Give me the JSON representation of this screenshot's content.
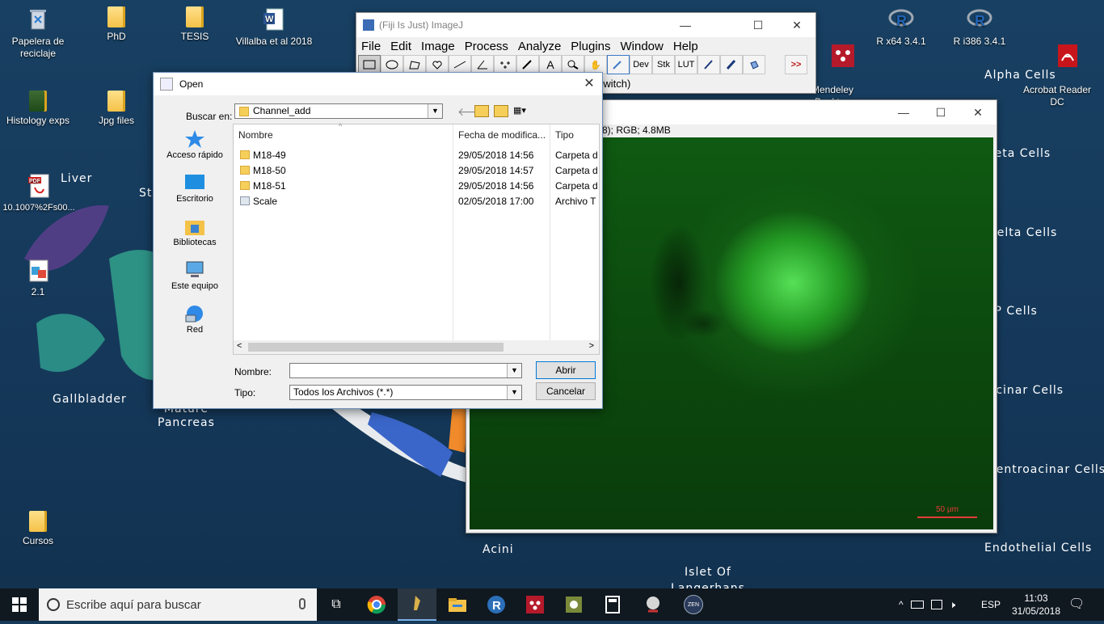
{
  "desktop": {
    "icons": [
      {
        "label": "Papelera de\nreciclaje",
        "icon": "recycle-bin-icon"
      },
      {
        "label": "PhD",
        "icon": "folder-icon"
      },
      {
        "label": "TESIS",
        "icon": "folder-icon"
      },
      {
        "label": "Villalba et al 2018",
        "icon": "word-doc-icon"
      },
      {
        "label": "Histology exps",
        "icon": "folder-icon"
      },
      {
        "label": "Jpg files",
        "icon": "folder-icon"
      },
      {
        "label": "10.1007%2Fs00...",
        "icon": "pdf-icon"
      },
      {
        "label": "2.1",
        "icon": "app-icon"
      },
      {
        "label": "Cursos",
        "icon": "folder-icon"
      },
      {
        "label": "Mendeley\nDesktop",
        "icon": "mendeley-icon"
      },
      {
        "label": "R x64 3.4.1",
        "icon": "r-icon"
      },
      {
        "label": "R i386 3.4.1",
        "icon": "r-icon"
      },
      {
        "label": "Acrobat Reader\nDC",
        "icon": "acrobat-icon"
      }
    ],
    "wallpaper_labels": [
      "Liver",
      "Gallbladder",
      "Mature\nPancreas",
      "Alpha Cells",
      "Beta Cells",
      "Delta Cells",
      "PP Cells",
      "Acinar Cells",
      "Centroacinar Cells",
      "Endothelial Cells",
      "Acini",
      "Islet Of\nLangerhans",
      "St"
    ]
  },
  "imagej": {
    "title": "(Fiji Is Just) ImageJ",
    "menu": [
      "File",
      "Edit",
      "Image",
      "Process",
      "Analyze",
      "Plugins",
      "Window",
      "Help"
    ],
    "tools": [
      "rectangle",
      "oval",
      "polygon",
      "freehand",
      "line",
      "angle",
      "multipoint",
      "wand",
      "text",
      "magnifier",
      "hand",
      "color-picker",
      "Dev",
      "Stk",
      "LUT",
      "pencil",
      "brush",
      "flood-fill",
      ">>"
    ],
    "status": "o switch)"
  },
  "image_window": {
    "subtitle": "8); RGB; 4.8MB",
    "scale_label": "50 µm"
  },
  "open_dialog": {
    "title": "Open",
    "look_in_label": "Buscar en:",
    "look_in_value": "Channel_add",
    "places": [
      "Acceso rápido",
      "Escritorio",
      "Bibliotecas",
      "Este equipo",
      "Red"
    ],
    "columns": [
      "Nombre",
      "Fecha de modifica...",
      "Tipo"
    ],
    "files": [
      {
        "name": "M18-49",
        "date": "29/05/2018 14:56",
        "type": "Carpeta d",
        "kind": "folder"
      },
      {
        "name": "M18-50",
        "date": "29/05/2018 14:57",
        "type": "Carpeta d",
        "kind": "folder"
      },
      {
        "name": "M18-51",
        "date": "29/05/2018 14:56",
        "type": "Carpeta d",
        "kind": "folder"
      },
      {
        "name": "Scale",
        "date": "02/05/2018 17:00",
        "type": "Archivo T",
        "kind": "file"
      }
    ],
    "filename_label": "Nombre:",
    "filename_value": "",
    "type_label": "Tipo:",
    "type_value": "Todos los Archivos (*.*)",
    "open_button": "Abrir",
    "cancel_button": "Cancelar"
  },
  "taskbar": {
    "search_placeholder": "Escribe aquí para buscar",
    "apps": [
      "task-view",
      "chrome",
      "fiji",
      "file-explorer",
      "r",
      "mendeley",
      "calculator",
      "cytoscape",
      "snipping",
      "zen"
    ],
    "zen_label": "ZEN",
    "language": "ESP",
    "time": "11:03",
    "date": "31/05/2018"
  }
}
